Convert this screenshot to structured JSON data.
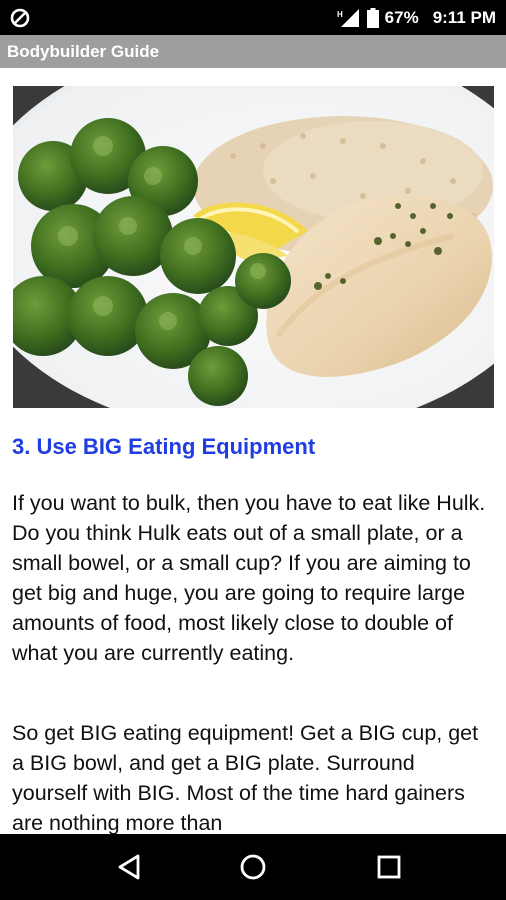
{
  "status_bar": {
    "battery_level": "67%",
    "time": "9:11 PM",
    "icons": [
      "blocked-circle-icon",
      "signal-icon",
      "battery-icon"
    ]
  },
  "app_bar": {
    "title": "Bodybuilder Guide"
  },
  "article": {
    "image": "plate-of-broccoli-rice-chicken-lemon",
    "heading": "3. Use BIG Eating Equipment",
    "paragraphs": [
      "If you want to bulk, then you have to eat like Hulk. Do you think Hulk eats out of a small plate, or a small bowel, or a small cup? If you are aiming to get big and huge, you are going to require large amounts of food, most likely close to double of what you are currently eating.",
      "So get BIG eating equipment! Get a BIG cup, get a BIG bowl, and get a BIG plate. Surround yourself with BIG. Most of the time hard gainers are nothing more than"
    ],
    "heading_color": "#1f3de0"
  },
  "nav_bar": {
    "icons": [
      "back-triangle-icon",
      "home-circle-icon",
      "recents-square-icon"
    ]
  }
}
